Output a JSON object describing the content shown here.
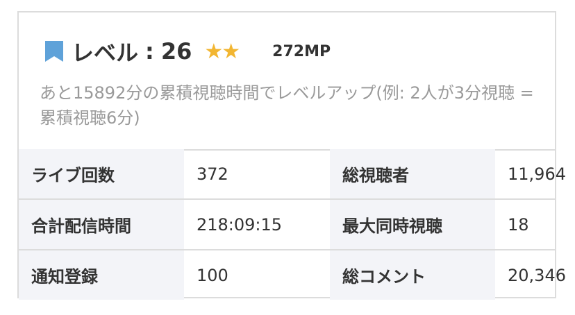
{
  "level": {
    "label": "レベル",
    "separator": ":",
    "value": "26",
    "stars": "★★",
    "stars_count": 2,
    "mp": "272MP"
  },
  "note": "あと15892分の累積視聴時間でレベルアップ(例: 2人が3分視聴 = 累積視聴6分)",
  "stats": [
    {
      "k1": "ライブ回数",
      "v1": "372",
      "k2": "総視聴者",
      "v2": "11,964"
    },
    {
      "k1": "合計配信時間",
      "v1": "218:09:15",
      "k2": "最大同時視聴",
      "v2": "18"
    },
    {
      "k1": "通知登録",
      "v1": "100",
      "k2": "総コメント",
      "v2": "20,346"
    }
  ],
  "colors": {
    "bookmark": "#5fa2d9",
    "star": "#f2b632",
    "note_text": "#9a9a9a",
    "key_bg": "#f3f4f8",
    "border": "#dcdcdc"
  },
  "icons": {
    "level": "bookmark-icon",
    "rating": "star-icon"
  }
}
